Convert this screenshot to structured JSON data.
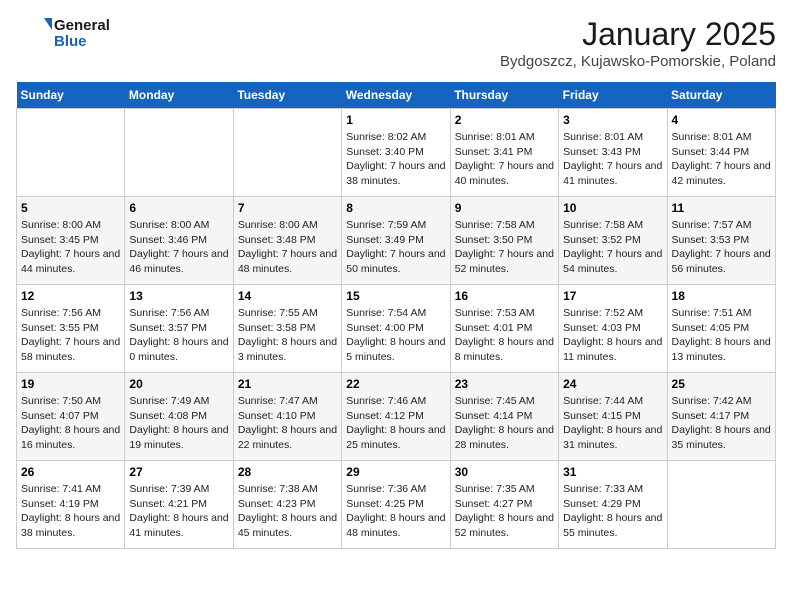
{
  "logo": {
    "line1": "General",
    "line2": "Blue"
  },
  "title": "January 2025",
  "subtitle": "Bydgoszcz, Kujawsko-Pomorskie, Poland",
  "days_of_week": [
    "Sunday",
    "Monday",
    "Tuesday",
    "Wednesday",
    "Thursday",
    "Friday",
    "Saturday"
  ],
  "weeks": [
    [
      {
        "num": "",
        "sunrise": "",
        "sunset": "",
        "daylight": ""
      },
      {
        "num": "",
        "sunrise": "",
        "sunset": "",
        "daylight": ""
      },
      {
        "num": "",
        "sunrise": "",
        "sunset": "",
        "daylight": ""
      },
      {
        "num": "1",
        "sunrise": "Sunrise: 8:02 AM",
        "sunset": "Sunset: 3:40 PM",
        "daylight": "Daylight: 7 hours and 38 minutes."
      },
      {
        "num": "2",
        "sunrise": "Sunrise: 8:01 AM",
        "sunset": "Sunset: 3:41 PM",
        "daylight": "Daylight: 7 hours and 40 minutes."
      },
      {
        "num": "3",
        "sunrise": "Sunrise: 8:01 AM",
        "sunset": "Sunset: 3:43 PM",
        "daylight": "Daylight: 7 hours and 41 minutes."
      },
      {
        "num": "4",
        "sunrise": "Sunrise: 8:01 AM",
        "sunset": "Sunset: 3:44 PM",
        "daylight": "Daylight: 7 hours and 42 minutes."
      }
    ],
    [
      {
        "num": "5",
        "sunrise": "Sunrise: 8:00 AM",
        "sunset": "Sunset: 3:45 PM",
        "daylight": "Daylight: 7 hours and 44 minutes."
      },
      {
        "num": "6",
        "sunrise": "Sunrise: 8:00 AM",
        "sunset": "Sunset: 3:46 PM",
        "daylight": "Daylight: 7 hours and 46 minutes."
      },
      {
        "num": "7",
        "sunrise": "Sunrise: 8:00 AM",
        "sunset": "Sunset: 3:48 PM",
        "daylight": "Daylight: 7 hours and 48 minutes."
      },
      {
        "num": "8",
        "sunrise": "Sunrise: 7:59 AM",
        "sunset": "Sunset: 3:49 PM",
        "daylight": "Daylight: 7 hours and 50 minutes."
      },
      {
        "num": "9",
        "sunrise": "Sunrise: 7:58 AM",
        "sunset": "Sunset: 3:50 PM",
        "daylight": "Daylight: 7 hours and 52 minutes."
      },
      {
        "num": "10",
        "sunrise": "Sunrise: 7:58 AM",
        "sunset": "Sunset: 3:52 PM",
        "daylight": "Daylight: 7 hours and 54 minutes."
      },
      {
        "num": "11",
        "sunrise": "Sunrise: 7:57 AM",
        "sunset": "Sunset: 3:53 PM",
        "daylight": "Daylight: 7 hours and 56 minutes."
      }
    ],
    [
      {
        "num": "12",
        "sunrise": "Sunrise: 7:56 AM",
        "sunset": "Sunset: 3:55 PM",
        "daylight": "Daylight: 7 hours and 58 minutes."
      },
      {
        "num": "13",
        "sunrise": "Sunrise: 7:56 AM",
        "sunset": "Sunset: 3:57 PM",
        "daylight": "Daylight: 8 hours and 0 minutes."
      },
      {
        "num": "14",
        "sunrise": "Sunrise: 7:55 AM",
        "sunset": "Sunset: 3:58 PM",
        "daylight": "Daylight: 8 hours and 3 minutes."
      },
      {
        "num": "15",
        "sunrise": "Sunrise: 7:54 AM",
        "sunset": "Sunset: 4:00 PM",
        "daylight": "Daylight: 8 hours and 5 minutes."
      },
      {
        "num": "16",
        "sunrise": "Sunrise: 7:53 AM",
        "sunset": "Sunset: 4:01 PM",
        "daylight": "Daylight: 8 hours and 8 minutes."
      },
      {
        "num": "17",
        "sunrise": "Sunrise: 7:52 AM",
        "sunset": "Sunset: 4:03 PM",
        "daylight": "Daylight: 8 hours and 11 minutes."
      },
      {
        "num": "18",
        "sunrise": "Sunrise: 7:51 AM",
        "sunset": "Sunset: 4:05 PM",
        "daylight": "Daylight: 8 hours and 13 minutes."
      }
    ],
    [
      {
        "num": "19",
        "sunrise": "Sunrise: 7:50 AM",
        "sunset": "Sunset: 4:07 PM",
        "daylight": "Daylight: 8 hours and 16 minutes."
      },
      {
        "num": "20",
        "sunrise": "Sunrise: 7:49 AM",
        "sunset": "Sunset: 4:08 PM",
        "daylight": "Daylight: 8 hours and 19 minutes."
      },
      {
        "num": "21",
        "sunrise": "Sunrise: 7:47 AM",
        "sunset": "Sunset: 4:10 PM",
        "daylight": "Daylight: 8 hours and 22 minutes."
      },
      {
        "num": "22",
        "sunrise": "Sunrise: 7:46 AM",
        "sunset": "Sunset: 4:12 PM",
        "daylight": "Daylight: 8 hours and 25 minutes."
      },
      {
        "num": "23",
        "sunrise": "Sunrise: 7:45 AM",
        "sunset": "Sunset: 4:14 PM",
        "daylight": "Daylight: 8 hours and 28 minutes."
      },
      {
        "num": "24",
        "sunrise": "Sunrise: 7:44 AM",
        "sunset": "Sunset: 4:15 PM",
        "daylight": "Daylight: 8 hours and 31 minutes."
      },
      {
        "num": "25",
        "sunrise": "Sunrise: 7:42 AM",
        "sunset": "Sunset: 4:17 PM",
        "daylight": "Daylight: 8 hours and 35 minutes."
      }
    ],
    [
      {
        "num": "26",
        "sunrise": "Sunrise: 7:41 AM",
        "sunset": "Sunset: 4:19 PM",
        "daylight": "Daylight: 8 hours and 38 minutes."
      },
      {
        "num": "27",
        "sunrise": "Sunrise: 7:39 AM",
        "sunset": "Sunset: 4:21 PM",
        "daylight": "Daylight: 8 hours and 41 minutes."
      },
      {
        "num": "28",
        "sunrise": "Sunrise: 7:38 AM",
        "sunset": "Sunset: 4:23 PM",
        "daylight": "Daylight: 8 hours and 45 minutes."
      },
      {
        "num": "29",
        "sunrise": "Sunrise: 7:36 AM",
        "sunset": "Sunset: 4:25 PM",
        "daylight": "Daylight: 8 hours and 48 minutes."
      },
      {
        "num": "30",
        "sunrise": "Sunrise: 7:35 AM",
        "sunset": "Sunset: 4:27 PM",
        "daylight": "Daylight: 8 hours and 52 minutes."
      },
      {
        "num": "31",
        "sunrise": "Sunrise: 7:33 AM",
        "sunset": "Sunset: 4:29 PM",
        "daylight": "Daylight: 8 hours and 55 minutes."
      },
      {
        "num": "",
        "sunrise": "",
        "sunset": "",
        "daylight": ""
      }
    ]
  ]
}
